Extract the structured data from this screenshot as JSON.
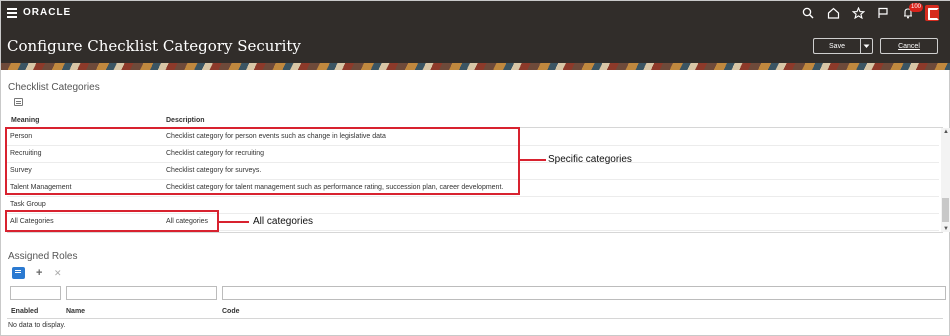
{
  "topbar": {
    "logo": "ORACLE",
    "icons": [
      "search-icon",
      "home-icon",
      "favorites-star-icon",
      "flag-icon",
      "notifications-bell-icon"
    ],
    "notification_count": "100"
  },
  "header": {
    "title": "Configure Checklist Category Security",
    "save_label": "Save",
    "cancel_label": "Cancel"
  },
  "categories": {
    "title": "Checklist Categories",
    "columns": {
      "meaning": "Meaning",
      "description": "Description"
    },
    "rows": [
      {
        "meaning": "Person",
        "description": "Checklist category for person events such as change in legislative data"
      },
      {
        "meaning": "Recruiting",
        "description": "Checklist category for recruiting"
      },
      {
        "meaning": "Survey",
        "description": "Checklist category for surveys."
      },
      {
        "meaning": "Talent Management",
        "description": "Checklist category for talent management such as performance rating, succession plan, career development."
      },
      {
        "meaning": "Task Group",
        "description": ""
      },
      {
        "meaning": "All Categories",
        "description": "All categories"
      }
    ]
  },
  "annotations": {
    "specific": "Specific categories",
    "all": "All categories"
  },
  "roles": {
    "title": "Assigned Roles",
    "columns": {
      "enabled": "Enabled",
      "name": "Name",
      "code": "Code"
    },
    "empty_text": "No data to display."
  },
  "colors": {
    "header_bg": "#312d2a",
    "highlight": "#d8222f",
    "accent": "#2b7ad1"
  }
}
